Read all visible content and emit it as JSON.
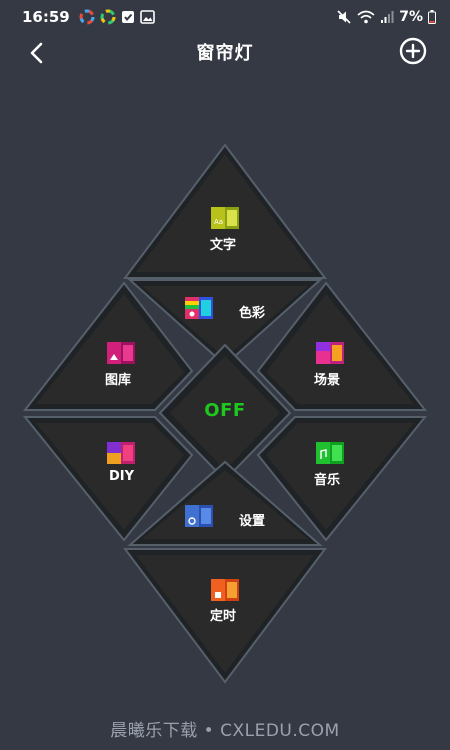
{
  "status": {
    "time": "16:59",
    "battery": "7%"
  },
  "header": {
    "title": "窗帘灯"
  },
  "tiles": {
    "text": "文字",
    "color": "色彩",
    "gallery": "图库",
    "scene": "场景",
    "power": "OFF",
    "diy": "DIY",
    "music": "音乐",
    "settings": "设置",
    "timer": "定时"
  },
  "colors": {
    "background": "#353944",
    "tile_face": "#2a2a2a",
    "tile_border": "#55606b",
    "power_off": "#1fc81f"
  },
  "watermark": "晨曦乐下载 • CXLEDU.COM"
}
